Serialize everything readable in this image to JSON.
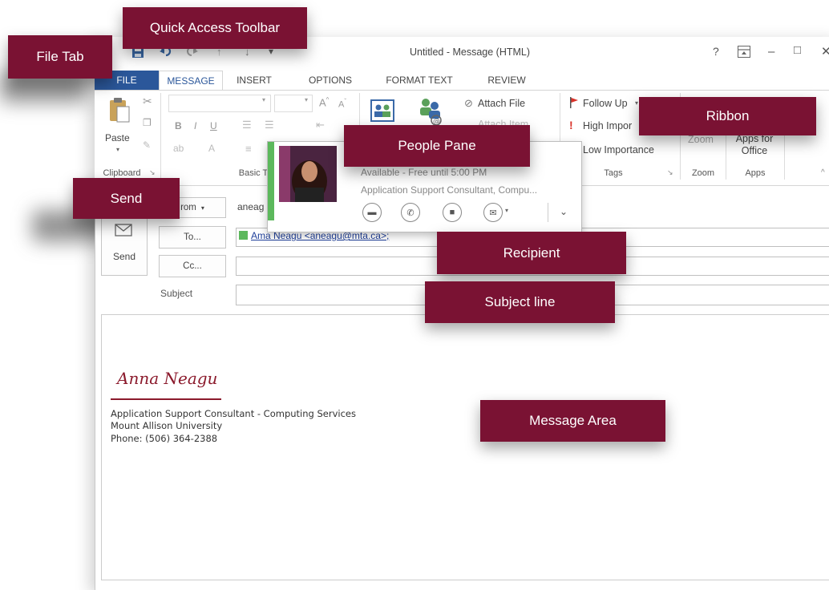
{
  "window": {
    "title": "Untitled - Message (HTML)",
    "help_icon": "?",
    "restore_icon": "restore-ribbon",
    "minimize_icon": "–",
    "maximize_icon": "□",
    "close_icon": "✕"
  },
  "qat": {
    "save_icon": "save",
    "undo_icon": "undo",
    "redo_icon": "redo",
    "up_icon": "↑",
    "down_icon": "↓",
    "more_icon": "▾"
  },
  "tabs": [
    "FILE",
    "MESSAGE",
    "INSERT",
    "OPTIONS",
    "FORMAT TEXT",
    "REVIEW"
  ],
  "ribbon": {
    "paste_label": "Paste",
    "clipboard_group": "Clipboard",
    "basic_text_group": "Basic T",
    "attach_file": "Attach File",
    "attach_item": "Attach Item",
    "follow_up": "Follow Up",
    "high_importance": "High Impor",
    "low_importance": "Low Importance",
    "tags_group": "Tags",
    "zoom_button": "Zoom",
    "zoom_group": "Zoom",
    "apps_for_office": "Apps for Office",
    "apps_group": "Apps"
  },
  "people_pane": {
    "status": "Available - Free until 5:00 PM",
    "title": "Application Support Consultant, Compu...",
    "status_color": "#5cb85c"
  },
  "compose": {
    "send_label": "Send",
    "from_button": "rom",
    "from_value": "aneag",
    "to_button": "To...",
    "cc_button": "Cc...",
    "subject_label": "Subject",
    "recipient": "Ama Neagu <aneagu@mta.ca>;",
    "subject_value": ""
  },
  "signature": {
    "name": "Anna Neagu",
    "line1": "Application Support Consultant - Computing Services",
    "line2": "Mount Allison University",
    "line3": "Phone: (506) 364-2388"
  },
  "callouts": {
    "qat": "Quick Access Toolbar",
    "file_tab": "File Tab",
    "ribbon": "Ribbon",
    "people_pane": "People Pane",
    "send": "Send",
    "recipient": "Recipient",
    "subject_line": "Subject line",
    "message_area": "Message Area"
  },
  "colors": {
    "callout_bg": "#7a1233",
    "file_tab_bg": "#2b579a",
    "accent_blue": "#2b579a",
    "presence_green": "#5cb85c"
  }
}
